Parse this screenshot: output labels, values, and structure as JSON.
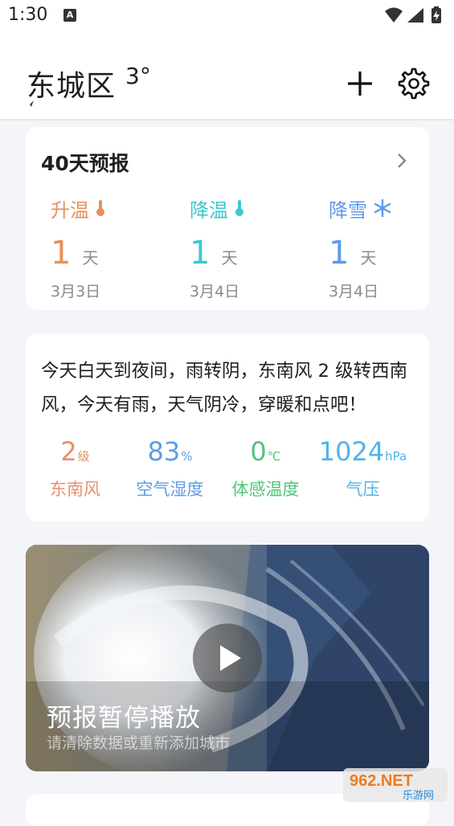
{
  "status": {
    "time": "1:30",
    "notif_glyph": "A",
    "icons": [
      "wifi-icon",
      "signal-icon",
      "battery-charging-icon"
    ]
  },
  "header": {
    "city": "东城区",
    "temperature": "3°",
    "add_icon": "plus-icon",
    "settings_icon": "gear-icon"
  },
  "forecast40": {
    "title": "40天预报",
    "items": [
      {
        "label": "升温",
        "count": "1",
        "unit": "天",
        "date": "3月3日",
        "color": "#e8905a",
        "icon": "thermometer-icon"
      },
      {
        "label": "降温",
        "count": "1",
        "unit": "天",
        "date": "3月4日",
        "color": "#3ec7cf",
        "icon": "thermometer-icon"
      },
      {
        "label": "降雪",
        "count": "1",
        "unit": "天",
        "date": "3月4日",
        "color": "#5c9aea",
        "icon": "snowflake-icon"
      }
    ]
  },
  "today": {
    "description": "今天白天到夜间，雨转阴，东南风 2 级转西南风，今天有雨，天气阴冷，穿暖和点吧！",
    "metrics": [
      {
        "value": "2",
        "unit": "级",
        "label": "东南风",
        "color": "#e8906a"
      },
      {
        "value": "83",
        "unit": "%",
        "label": "空气湿度",
        "color": "#5b9de8"
      },
      {
        "value": "0",
        "unit": "℃",
        "label": "体感温度",
        "color": "#4fc47a"
      },
      {
        "value": "1024",
        "unit": "hPa",
        "label": "气压",
        "color": "#4fb4e8"
      }
    ]
  },
  "video": {
    "title": "预报暂停播放",
    "subtitle": "请清除数据或重新添加城市",
    "play_icon": "play-icon"
  },
  "watermark": {
    "main": "962.NET",
    "sub": "乐游网"
  }
}
